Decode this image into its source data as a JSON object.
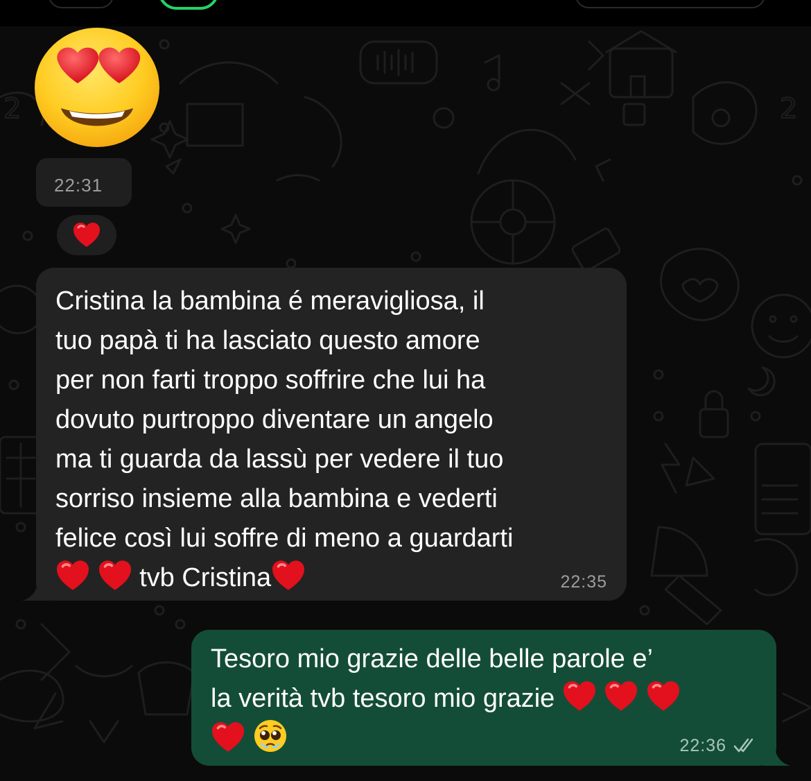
{
  "colors": {
    "background": "#0b0b0b",
    "incoming_bubble": "#232323",
    "outgoing_bubble": "#144d37",
    "text": "#ffffff",
    "timestamp": "#9d9d9d",
    "outgoing_timestamp": "#a6c8b8",
    "accent_green": "#25d366"
  },
  "chat": {
    "sticker": {
      "icon": "heart-eyes-emoji-icon",
      "time": "22:31"
    },
    "reaction": {
      "icon": "red-heart-icon"
    },
    "incoming_message": {
      "lines": [
        "Cristina la bambina é meravigliosa, il",
        "tuo papà ti ha lasciato questo amore",
        "per non farti troppo soffrire che lui ha",
        "dovuto purtroppo diventare un angelo",
        "ma ti guarda da lassù per vedere il tuo",
        "sorriso insieme alla bambina e vederti",
        "felice così lui soffre di meno a guardarti"
      ],
      "closing_text": " tvb Cristina",
      "time": "22:35"
    },
    "outgoing_message": {
      "line1": "Tesoro mio grazie delle belle parole e’",
      "line2": "la verità tvb tesoro mio grazie ",
      "time": "22:36",
      "status_icon": "double-check-read-icon"
    }
  }
}
